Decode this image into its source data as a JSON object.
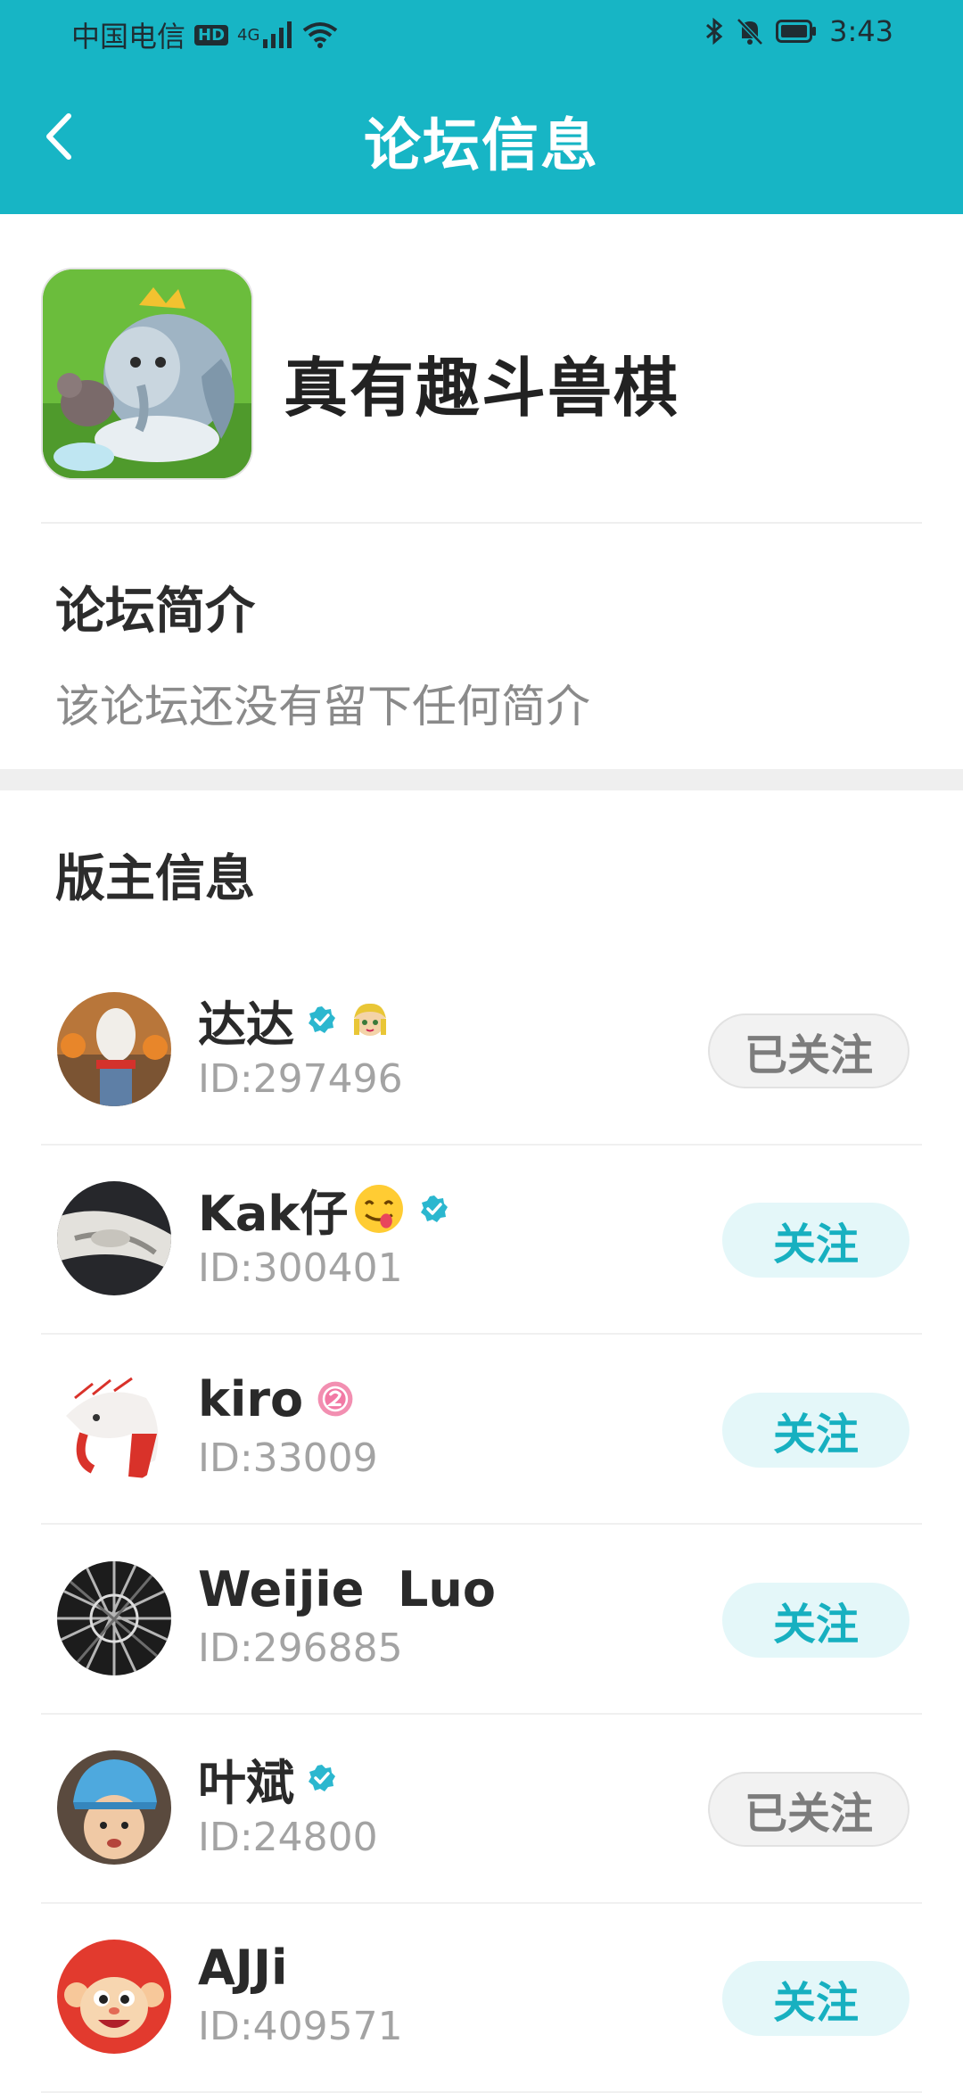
{
  "status_bar": {
    "carrier": "中国电信",
    "hd": "HD",
    "net": "4G",
    "time": "3:43"
  },
  "header": {
    "title": "论坛信息",
    "back_icon": "chevron-left-icon"
  },
  "forum": {
    "name": "真有趣斗兽棋"
  },
  "intro": {
    "title": "论坛简介",
    "text": "该论坛还没有留下任何简介"
  },
  "moderators": {
    "title": "版主信息",
    "items": [
      {
        "name": "达达",
        "id": "ID:297496",
        "follow": "已关注",
        "followed": true,
        "verified": true,
        "badge": "emoji-girl"
      },
      {
        "name": "Kak仔",
        "id": "ID:300401",
        "follow": "关注",
        "followed": false,
        "verified": true,
        "badge": "emoji-yum"
      },
      {
        "name": "kiro",
        "id": "ID:33009",
        "follow": "关注",
        "followed": false,
        "verified": false,
        "badge": "level-2"
      },
      {
        "name": "Weijie  Luo",
        "id": "ID:296885",
        "follow": "关注",
        "followed": false,
        "verified": false,
        "badge": ""
      },
      {
        "name": "叶斌",
        "id": "ID:24800",
        "follow": "已关注",
        "followed": true,
        "verified": true,
        "badge": ""
      },
      {
        "name": "AJJi",
        "id": "ID:409571",
        "follow": "关注",
        "followed": false,
        "verified": false,
        "badge": ""
      }
    ]
  },
  "colors": {
    "brand": "#17b5c5",
    "follow_text": "#17b0c0",
    "followed_text": "#7c7c7c"
  }
}
